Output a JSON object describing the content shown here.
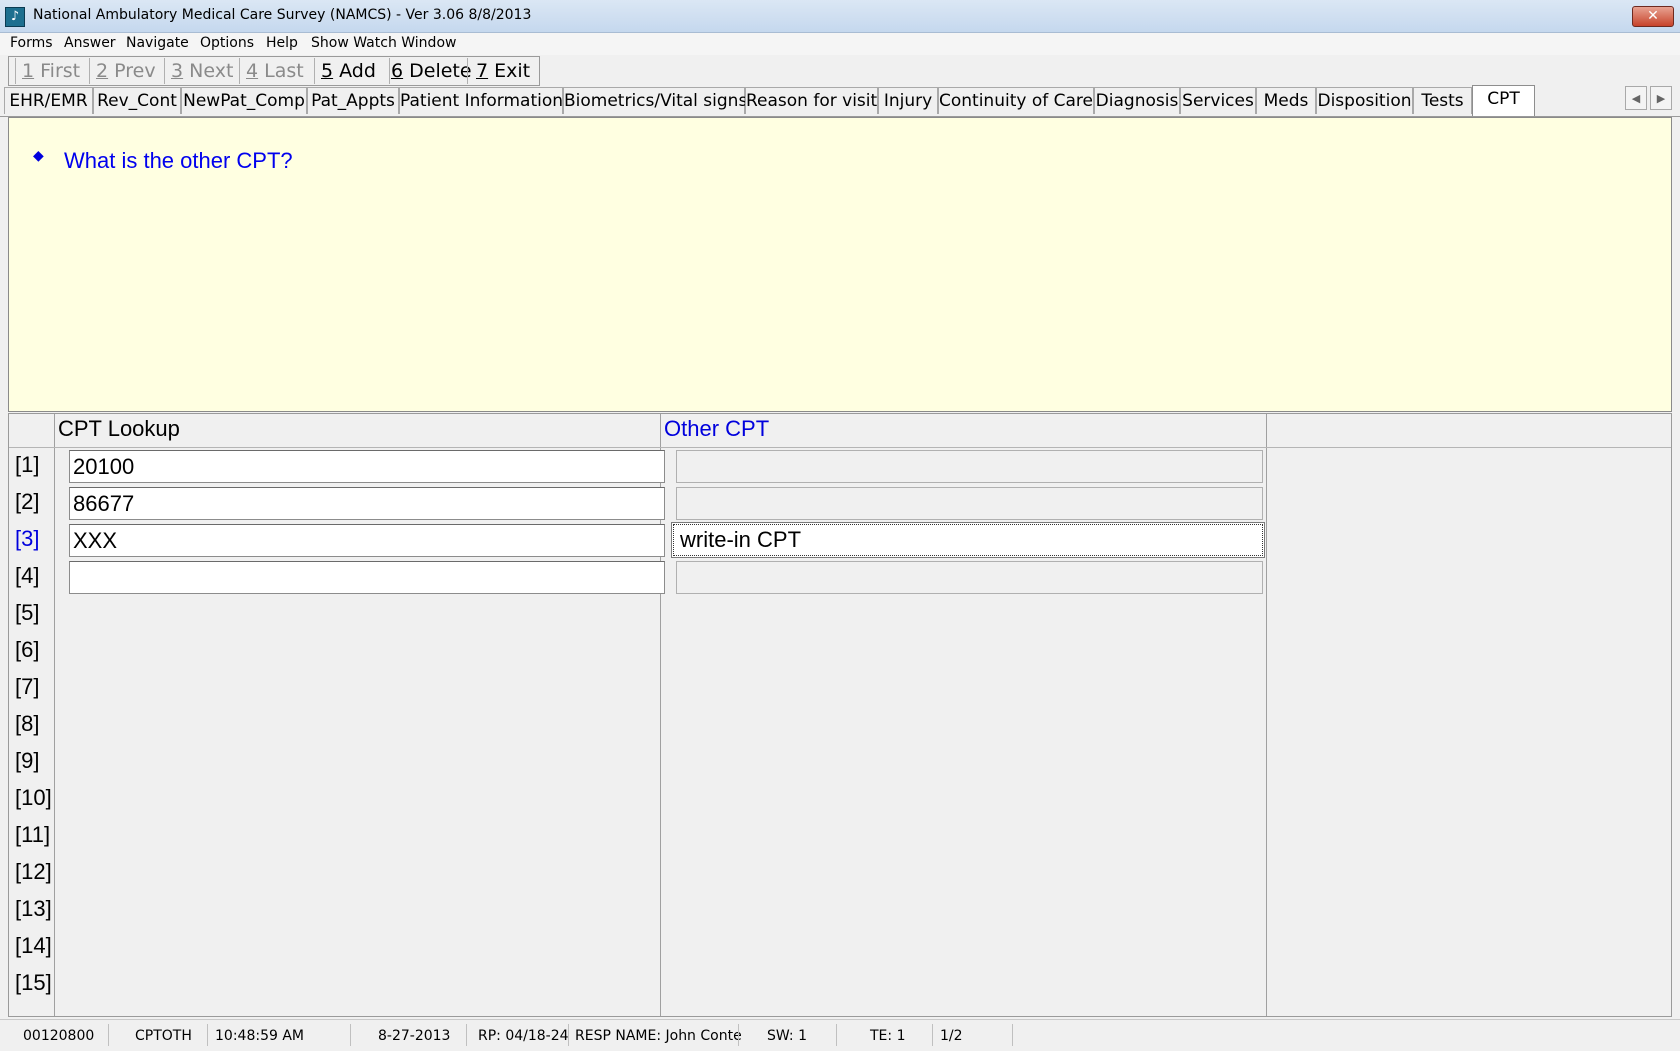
{
  "window": {
    "title": "National Ambulatory Medical Care Survey (NAMCS) - Ver 3.06 8/8/2013",
    "close_label": "✕"
  },
  "menu": [
    "Forms",
    "Answer",
    "Navigate",
    "Options",
    "Help",
    "Show Watch Window"
  ],
  "nav": [
    {
      "key": "1",
      "label": "First",
      "enabled": false
    },
    {
      "key": "2",
      "label": "Prev",
      "enabled": false
    },
    {
      "key": "3",
      "label": "Next",
      "enabled": false
    },
    {
      "key": "4",
      "label": "Last",
      "enabled": false
    },
    {
      "key": "5",
      "label": "Add",
      "enabled": true
    },
    {
      "key": "6",
      "label": "Delete",
      "enabled": true
    },
    {
      "key": "7",
      "label": "Exit",
      "enabled": true
    }
  ],
  "tabs": [
    "EHR/EMR",
    "Rev_Cont",
    "NewPat_Comp",
    "Pat_Appts",
    "Patient Information",
    "Biometrics/Vital signs",
    "Reason for visit",
    "Injury",
    "Continuity of Care",
    "Diagnosis",
    "Services",
    "Meds",
    "Disposition",
    "Tests",
    "CPT"
  ],
  "active_tab": "CPT",
  "question": "What is the other CPT?",
  "grid": {
    "headers": {
      "col1": "CPT Lookup",
      "col2": "Other CPT"
    },
    "row_labels": [
      "[1]",
      "[2]",
      "[3]",
      "[4]",
      "[5]",
      "[6]",
      "[7]",
      "[8]",
      "[9]",
      "[10]",
      "[11]",
      "[12]",
      "[13]",
      "[14]",
      "[15]"
    ],
    "current_row": "[3]",
    "rows": [
      {
        "lookup": "20100",
        "other": ""
      },
      {
        "lookup": "86677",
        "other": ""
      },
      {
        "lookup": "XXX",
        "other": "write-in CPT"
      },
      {
        "lookup": "",
        "other": ""
      }
    ]
  },
  "status": {
    "case_id": "00120800",
    "field": "CPTOTH",
    "time": "10:48:59 AM",
    "date": "8-27-2013",
    "rp": "RP: 04/18-24",
    "resp_name": "RESP NAME: John  Conte",
    "sw": "SW: 1",
    "te": "TE: 1",
    "page": "1/2"
  }
}
